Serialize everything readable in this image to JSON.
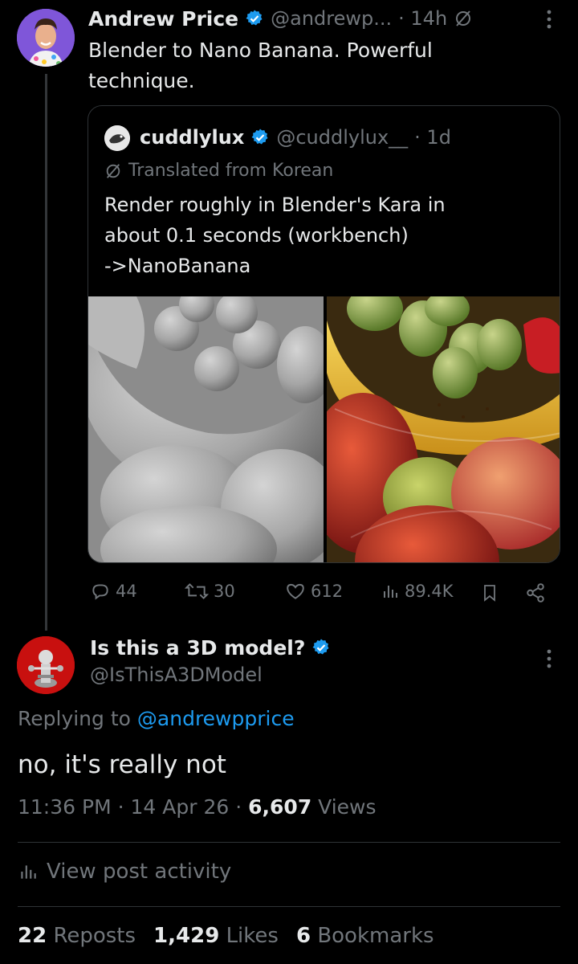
{
  "main_post": {
    "author_name": "Andrew Price",
    "handle": "@andrewp...",
    "time": "· 14h",
    "text_line1": "Blender to Nano Banana. Powerful",
    "text_line2": "technique."
  },
  "quoted_post": {
    "author_name": "cuddlylux",
    "handle": "@cuddlylux__",
    "time": "· 1d",
    "translated_label": "Translated from Korean",
    "text_line1": "Render roughly in Blender's Kara in",
    "text_line2": "about 0.1 seconds (workbench)",
    "text_line3": "->NanoBanana"
  },
  "actions": {
    "replies": "44",
    "reposts": "30",
    "likes": "612",
    "views": "89.4K"
  },
  "reply_post": {
    "author_name": "Is this a 3D model?",
    "handle": "@IsThisA3DModel",
    "replying_prefix": "Replying to",
    "replying_to": "@andrewpprice",
    "text": "no, it's really not",
    "time": "11:36 PM",
    "date": "14 Apr 26",
    "views_count": "6,607",
    "views_label": "Views",
    "view_activity": "View post activity",
    "reposts_count": "22",
    "reposts_label": "Reposts",
    "likes_count": "1,429",
    "likes_label": "Likes",
    "bookmarks_count": "6",
    "bookmarks_label": "Bookmarks"
  },
  "colors": {
    "background": "#000000",
    "text": "#e7e9ea",
    "muted": "#71767b",
    "accent": "#1d9bf0",
    "border": "#2f3336"
  },
  "icons": [
    "verified-badge-icon",
    "translate-icon",
    "more-options-icon",
    "reply-icon",
    "repost-icon",
    "like-icon",
    "views-icon",
    "bookmark-icon",
    "share-icon",
    "analytics-icon"
  ]
}
